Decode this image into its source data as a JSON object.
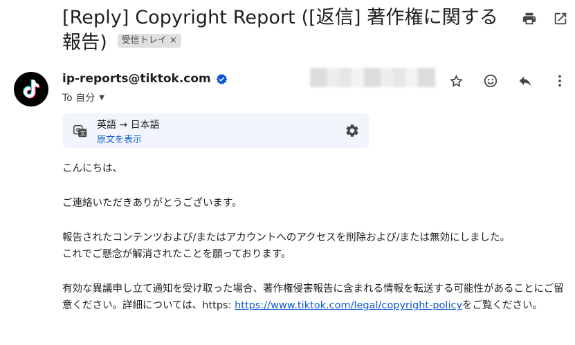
{
  "email": {
    "subject": "[Reply] Copyright Report ([返信] 著作権に関する報告)",
    "label_chip": "受信トレイ",
    "label_chip_close": "×",
    "sender": "ip-reports@tiktok.com",
    "to_prefix": "To 自分",
    "translate": {
      "languages": "英語 → 日本語",
      "show_original": "原文を表示"
    },
    "body": {
      "greeting": "こんにちは、",
      "thanks": "ご連絡いただきありがとうございます。",
      "para1_line1": "報告されたコンテンツおよび/またはアカウントへのアクセスを削除および/または無効にしました。",
      "para1_line2": "これでご懸念が解消されたことを願っております。",
      "para2_before_link": "有効な異議申し立て通知を受け取った場合、著作権侵害報告に含まれる情報を転送する可能性があることにご留意ください。詳細については、https: ",
      "link": "https://www.tiktok.com/legal/copyright-policy",
      "para2_after_link": "をご覧ください。"
    }
  },
  "icons": {
    "print": "print-icon",
    "open_new_window": "open-in-new-icon",
    "star": "star-icon",
    "emoji": "emoji-icon",
    "reply": "reply-icon",
    "more": "more-vert-icon",
    "translate": "translate-icon",
    "settings": "gear-icon",
    "verified": "verified-badge-icon",
    "avatar": "tiktok-logo"
  },
  "colors": {
    "link": "#0b57d0",
    "verified": "#0b57d0",
    "translate_bg": "#f2f6fc",
    "chip_bg": "#e0e0e0"
  }
}
